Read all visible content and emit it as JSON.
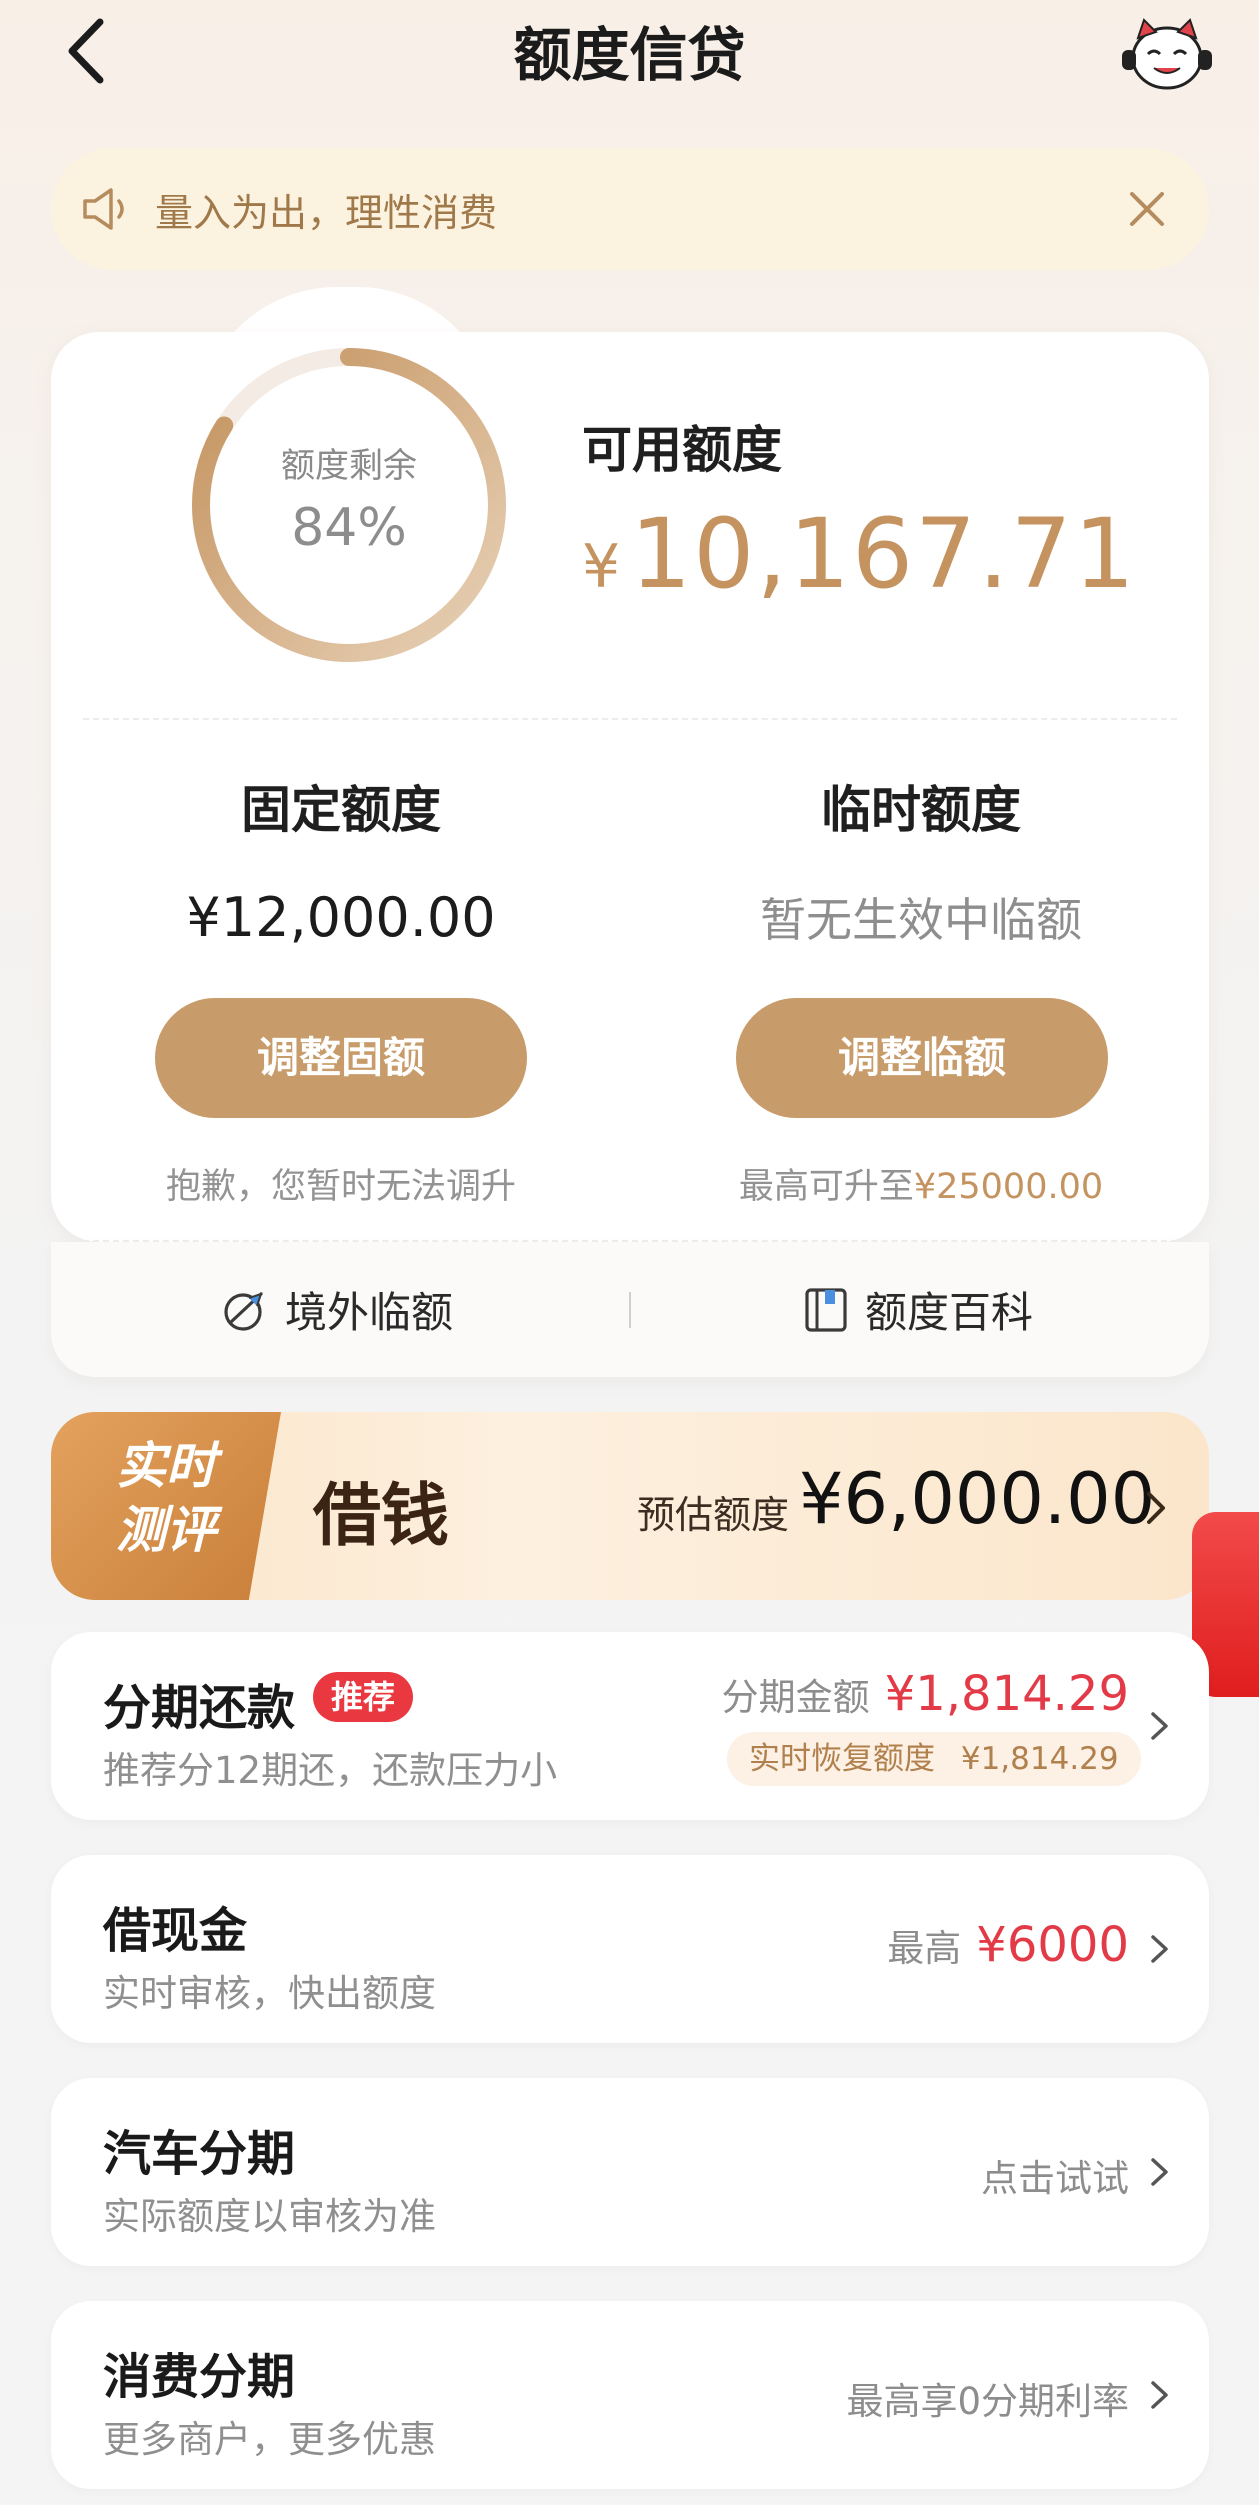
{
  "header": {
    "title": "额度信贷"
  },
  "notice": {
    "text": "量入为出，理性消费"
  },
  "credit": {
    "ring_label": "额度剩余",
    "ring_percent": "84%",
    "remaining_fraction": 0.84,
    "available_label": "可用额度",
    "currency": "¥",
    "available_amount": "10,167.71",
    "fixed": {
      "title": "固定额度",
      "amount": "¥12,000.00",
      "button": "调整固额",
      "note": "抱歉，您暂时无法调升"
    },
    "temporary": {
      "title": "临时额度",
      "status": "暂无生效中临额",
      "button": "调整临额",
      "note_prefix": "最高可升至",
      "note_amount": "¥25000.00"
    }
  },
  "quick_links": [
    {
      "label": "境外临额",
      "icon": "plane-globe-icon"
    },
    {
      "label": "额度百科",
      "icon": "book-icon"
    }
  ],
  "borrow_banner": {
    "tag": "实时测评",
    "tag_line1": "实时",
    "tag_line2": "测评",
    "title": "借钱",
    "estimate_label": "预估额度",
    "estimate_value": "¥6,000.00"
  },
  "products": [
    {
      "title": "分期还款",
      "badge": "推荐",
      "subtitle": "推荐分12期还，还款压力小",
      "right_label": "分期金额",
      "right_value": "¥1,814.29",
      "extra_label": "实时恢复额度",
      "extra_value": "¥1,814.29"
    },
    {
      "title": "借现金",
      "subtitle": "实时审核，快出额度",
      "right_label": "最高",
      "right_value": "¥6000"
    },
    {
      "title": "汽车分期",
      "subtitle": "实际额度以审核为准",
      "right_label": "点击试试"
    },
    {
      "title": "消费分期",
      "subtitle": "更多商户，更多优惠",
      "right_label": "最高享0分期利率"
    }
  ],
  "colors": {
    "gold": "#c4935f",
    "button_gold": "#c79b6a",
    "red": "#e33a48",
    "notice_bg": "#fcf2e0"
  }
}
